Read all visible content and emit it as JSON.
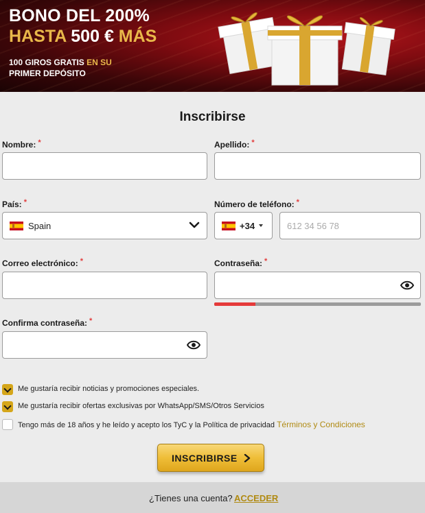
{
  "colors": {
    "accent_gold": "#e9b84a",
    "banner_red": "#7d0b10",
    "required": "#e23b3b",
    "link_gold": "#b08a12",
    "strength_weak": "#e53a3a"
  },
  "banner": {
    "line1": "BONO DEL 200%",
    "line2_prefix": "HASTA ",
    "line2_amount": "500 €",
    "line2_suffix": " MÁS",
    "line3_white": "100 GIROS GRATIS",
    "line3_gold": " EN SU",
    "line3_tail": "PRIMER DEPÓSITO",
    "art": "gift-boxes"
  },
  "form": {
    "title": "Inscribirse",
    "required_mark": "*",
    "first_name": {
      "label": "Nombre:",
      "value": ""
    },
    "last_name": {
      "label": "Apellido:",
      "value": ""
    },
    "country": {
      "label": "País:",
      "selected": "Spain",
      "flag_icon": "spain-flag-icon"
    },
    "phone": {
      "label": "Número de teléfono:",
      "dial_code": "+34",
      "placeholder": "612 34 56 78",
      "value": ""
    },
    "email": {
      "label": "Correo electrónico:",
      "value": ""
    },
    "password": {
      "label": "Contraseña:",
      "value": "",
      "strength_fraction": 0.2
    },
    "confirm_password": {
      "label": "Confirma contraseña:",
      "value": ""
    },
    "consents": [
      {
        "text": "Me gustaría recibir noticias y promociones especiales.",
        "checked": true
      },
      {
        "text": "Me gustaría recibir ofertas exclusivas por WhatsApp/SMS/Otros Servicios",
        "checked": true
      },
      {
        "text": "Tengo más de 18 años y he leído y acepto los TyC y la Política de privacidad ",
        "link": "Términos y Condiciones",
        "checked": false
      }
    ],
    "submit_label": "INSCRIBIRSE"
  },
  "footer": {
    "question": "¿Tienes una cuenta?",
    "link": "ACCEDER"
  }
}
